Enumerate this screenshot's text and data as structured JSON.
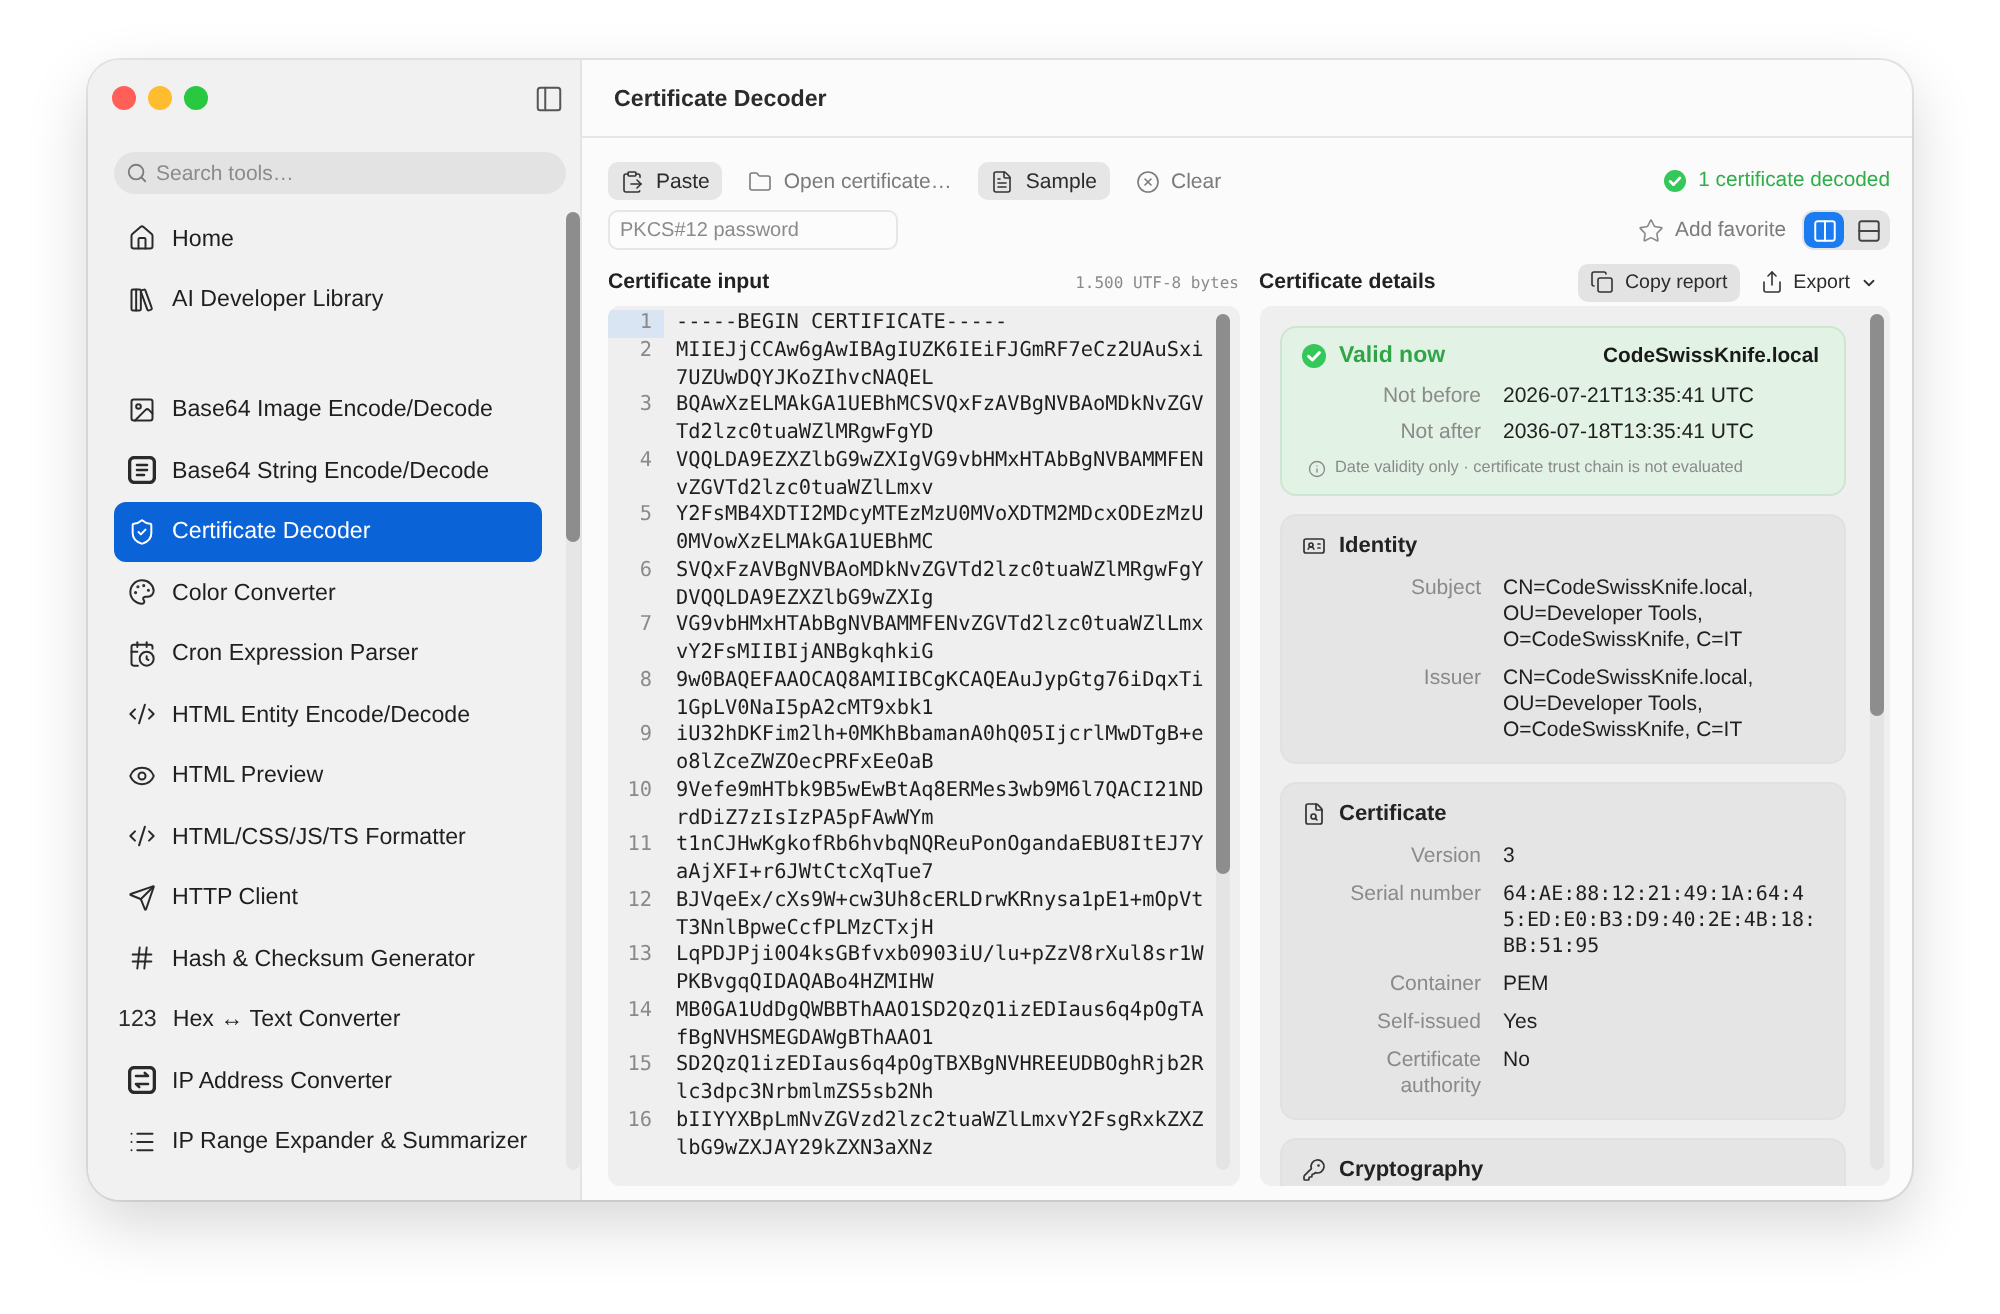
{
  "window": {
    "title": "Certificate Decoder"
  },
  "sidebar": {
    "search": {
      "placeholder": "Search tools…"
    },
    "groups": [
      {
        "items": [
          {
            "label": "Home",
            "selected": false
          },
          {
            "label": "AI Developer Library",
            "selected": false
          }
        ]
      },
      {
        "items": [
          {
            "label": "Base64 Image Encode/Decode",
            "selected": false
          },
          {
            "label": "Base64 String Encode/Decode",
            "selected": false
          },
          {
            "label": "Certificate Decoder",
            "selected": true
          },
          {
            "label": "Color Converter",
            "selected": false
          },
          {
            "label": "Cron Expression Parser",
            "selected": false
          },
          {
            "label": "HTML Entity Encode/Decode",
            "selected": false
          },
          {
            "label": "HTML Preview",
            "selected": false
          },
          {
            "label": "HTML/CSS/JS/TS Formatter",
            "selected": false
          },
          {
            "label": "HTTP Client",
            "selected": false
          },
          {
            "label": "Hash & Checksum Generator",
            "selected": false
          },
          {
            "label": "Hex ↔ Text Converter",
            "glyph": "123",
            "selected": false
          },
          {
            "label": "IP Address Converter",
            "selected": false
          },
          {
            "label": "IP Range Expander & Summarizer",
            "selected": false
          }
        ]
      }
    ]
  },
  "toolbar": {
    "buttons": [
      {
        "label": "Paste",
        "kind": "filled"
      },
      {
        "label": "Open certificate…",
        "kind": "plain"
      },
      {
        "label": "Sample",
        "kind": "filled"
      },
      {
        "label": "Clear",
        "kind": "plain"
      }
    ],
    "status": {
      "text": "1 certificate decoded",
      "kind": "success"
    }
  },
  "password_field": {
    "placeholder": "PKCS#12 password"
  },
  "favorite": {
    "label": "Add favorite",
    "favorited": false
  },
  "layout_toggle": [
    {
      "selected": true
    },
    {
      "selected": false
    }
  ],
  "input_panel": {
    "title": "Certificate input",
    "byte_count": "1.500 UTF-8 bytes",
    "lines": [
      {
        "number": "1",
        "text": "-----BEGIN CERTIFICATE-----",
        "current": true
      },
      {
        "number": "2",
        "text": "MIIEJjCCAw6gAwIBAgIUZK6IEiFJGmRF7eCz2UAuSxi7UZUwDQYJKoZIhvcNAQEL",
        "current": false
      },
      {
        "number": "3",
        "text": "BQAwXzELMAkGA1UEBhMCSVQxFzAVBgNVBAoMDkNvZGVTd2lzc0tuaWZlMRgwFgYD",
        "current": false
      },
      {
        "number": "4",
        "text": "VQQLDA9EZXZlbG9wZXIgVG9vbHMxHTAbBgNVBAMMFENvZGVTd2lzc0tuaWZlLmxv",
        "current": false
      },
      {
        "number": "5",
        "text": "Y2FsMB4XDTI2MDcyMTEzMzU0MVoXDTM2MDcxODEzMzU0MVowXzELMAkGA1UEBhMC",
        "current": false
      },
      {
        "number": "6",
        "text": "SVQxFzAVBgNVBAoMDkNvZGVTd2lzc0tuaWZlMRgwFgYDVQQLDA9EZXZlbG9wZXIg",
        "current": false
      },
      {
        "number": "7",
        "text": "VG9vbHMxHTAbBgNVBAMMFENvZGVTd2lzc0tuaWZlLmxvY2FsMIIBIjANBgkqhkiG",
        "current": false
      },
      {
        "number": "8",
        "text": "9w0BAQEFAAOCAQ8AMIIBCgKCAQEAuJypGtg76iDqxTi1GpLV0NaI5pA2cMT9xbk1",
        "current": false
      },
      {
        "number": "9",
        "text": "iU32hDKFim2lh+0MKhBbamanA0hQ05IjcrlMwDTgB+eo8lZceZWZOecPRFxEeOaB",
        "current": false
      },
      {
        "number": "10",
        "text": "9Vefe9mHTbk9B5wEwBtAq8ERMes3wb9M6l7QACI21NDrdDiZ7zIsIzPA5pFAwWYm",
        "current": false
      },
      {
        "number": "11",
        "text": "t1nCJHwKgkofRb6hvbqNQReuPonOgandaEBU8ItEJ7YaAjXFI+r6JWtCtcXqTue7",
        "current": false
      },
      {
        "number": "12",
        "text": "BJVqeEx/cXs9W+cw3Uh8cERLDrwKRnysa1pE1+mOpVtT3NnlBpweCcfPLMzCTxjH",
        "current": false
      },
      {
        "number": "13",
        "text": "LqPDJPji0O4ksGBfvxb0903iU/lu+pZzV8rXul8sr1WPKBvgqQIDAQABo4HZMIHW",
        "current": false
      },
      {
        "number": "14",
        "text": "MB0GA1UdDgQWBBThAAO1SD2QzQ1izEDIaus6q4pOgTAfBgNVHSMEGDAWgBThAAO1",
        "current": false
      },
      {
        "number": "15",
        "text": "SD2QzQ1izEDIaus6q4pOgTBXBgNVHREEUDBOghRjb2Rlc3dpc3NrbmlmZS5sb2Nh",
        "current": false
      },
      {
        "number": "16",
        "text": "bIIYYXBpLmNvZGVzd2lzc2tuaWZlLmxvY2FsgRxkZXZlbG9wZXJAY29kZXN3aXNz",
        "current": false
      }
    ]
  },
  "details_panel": {
    "title": "Certificate details",
    "actions": [
      {
        "label": "Copy report",
        "kind": "filled"
      },
      {
        "label": "Export",
        "kind": "menu"
      }
    ],
    "validity": {
      "status": "Valid now",
      "valid": true,
      "name": "CodeSwissKnife.local",
      "fields": [
        {
          "label": "Not before",
          "value": "2026-07-21T13:35:41 UTC"
        },
        {
          "label": "Not after",
          "value": "2036-07-18T13:35:41 UTC"
        }
      ],
      "note": "Date validity only · certificate trust chain is not evaluated"
    },
    "sections": [
      {
        "title": "Identity",
        "fields": [
          {
            "label": "Subject",
            "value": "CN=CodeSwissKnife.local, OU=Developer Tools, O=CodeSwissKnife, C=IT"
          },
          {
            "label": "Issuer",
            "value": "CN=CodeSwissKnife.local, OU=Developer Tools, O=CodeSwissKnife, C=IT"
          }
        ]
      },
      {
        "title": "Certificate",
        "fields": [
          {
            "label": "Version",
            "value": "3"
          },
          {
            "label": "Serial number",
            "value": "64:AE:88:12:21:49:1A:64:45:ED:E0:B3:D9:40:2E:4B:18:BB:51:95",
            "mono": true
          },
          {
            "label": "Container",
            "value": "PEM"
          },
          {
            "label": "Self-issued",
            "value": "Yes"
          },
          {
            "label": "Certificate authority",
            "value": "No"
          }
        ]
      },
      {
        "title": "Cryptography"
      }
    ]
  }
}
